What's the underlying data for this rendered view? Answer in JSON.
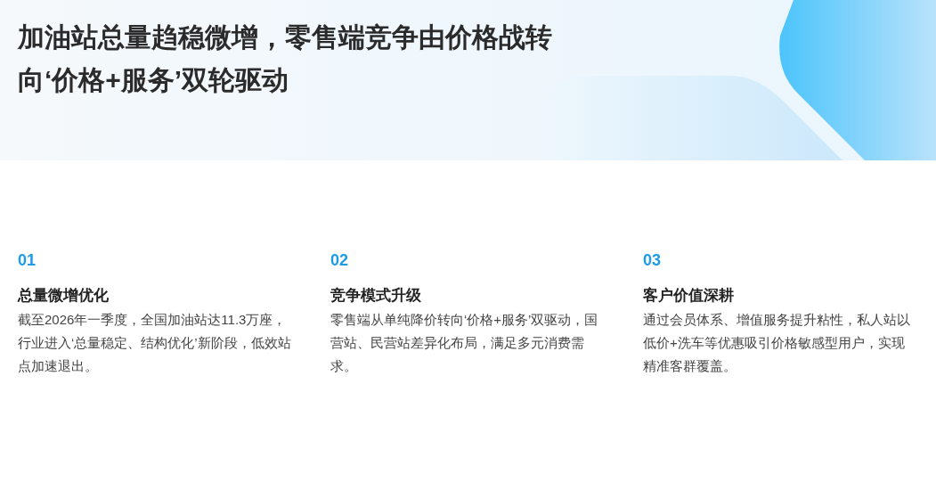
{
  "header": {
    "title": "加油站总量趋稳微增，零售端竞争由价格战转向‘价格+服务’双轮驱动"
  },
  "points": [
    {
      "number": "01",
      "heading": "总量微增优化",
      "body": "截至2026年一季度，全国加油站达11.3万座，行业进入‘总量稳定、结构优化’新阶段，低效站点加速退出。"
    },
    {
      "number": "02",
      "heading": "竞争模式升级",
      "body": "零售端从单纯降价转向‘价格+服务’双驱动，国营站、民营站差异化布局，满足多元消费需求。"
    },
    {
      "number": "03",
      "heading": "客户价值深耕",
      "body": "通过会员体系、增值服务提升粘性，私人站以低价+洗车等优惠吸引价格敏感型用户，实现精准客群覆盖。"
    }
  ]
}
